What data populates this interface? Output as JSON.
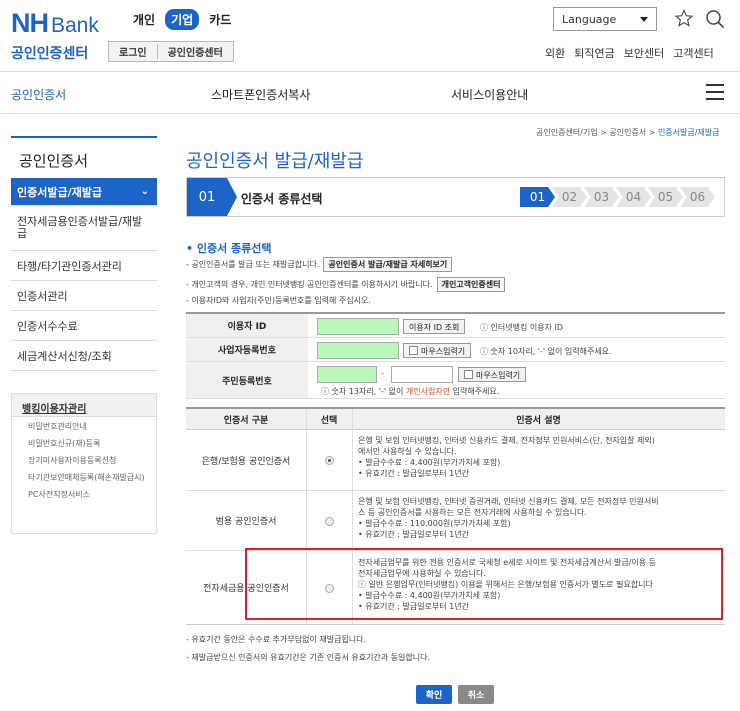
{
  "header": {
    "logo_nh": "NH",
    "logo_bank": "Bank",
    "biz_tabs": [
      "개인",
      "기업",
      "카드"
    ],
    "language_label": "Language",
    "site_title": "공인인증센터",
    "login_label": "로그인",
    "center_label": "공인인증센터",
    "util_links": [
      "외환",
      "퇴직연금",
      "보안센터",
      "고객센터"
    ]
  },
  "gnb": {
    "items": [
      "공인인증서",
      "스마트폰인증서복사",
      "서비스이용안내"
    ]
  },
  "sidebar": {
    "title": "공인인증서",
    "items": [
      {
        "label": "인증서발급/재발급",
        "chevron": "⌄"
      },
      {
        "label": "전자세금용인증서발급/재발급"
      },
      {
        "label": "타행/타기관인증서관리"
      },
      {
        "label": "인증서관리"
      },
      {
        "label": "인증서수수료"
      },
      {
        "label": "세금계산서신청/조회"
      }
    ],
    "banking": {
      "title": "뱅킹이용자관리",
      "items": [
        "비밀번호관리안내",
        "비밀번호신규(재)등록",
        "장기미사용자이용등록신청",
        "타기관보안매체등록(해손재발급시)",
        "PC사전지정서비스"
      ]
    }
  },
  "breadcrumb": {
    "path": "공인인증센터/기업 > 공인인증서 >",
    "current": "인증서발급/재발급"
  },
  "page_title": "공인인증서 발급/재발급",
  "step": {
    "number": "01",
    "label": "인증서 종류선택",
    "steps": [
      "01",
      "02",
      "03",
      "04",
      "05",
      "06"
    ]
  },
  "section_title": "• 인증서 종류선택",
  "notes": {
    "n1": "- 공인인증서를 발급 또는 재발급합니다.",
    "n1_btn": "공인인증서 발급/재발급 자세히보기",
    "n2": "- 개인고객의 경우, 개인 인터넷뱅킹 공인인증센터를 이용하시기 바랍니다.",
    "n2_btn": "개인고객인증센터",
    "n3": "- 이용자ID와 사업자(주민)등록번호를 입력해 주십시오."
  },
  "form": {
    "user_id_label": "이용자 ID",
    "user_id_btn": "이용자 ID 조회",
    "user_id_help": "ⓘ 인터넷뱅킹 이용자 ID",
    "biz_no_label": "사업자등록번호",
    "keyboard_label": "마우스입력기",
    "biz_no_help": "ⓘ 숫자 10자리, '-' 없이 입력해주세요.",
    "rrn_label": "주민등록번호",
    "dash": "-",
    "rrn_help_pre": "ⓘ 숫자 13자리, '-' 없이",
    "rrn_help_red": "개인사업자만",
    "rrn_help_post": "입력해주세요."
  },
  "cert_table": {
    "headers": [
      "인증서 구분",
      "선택",
      "인증서 설명"
    ],
    "rows": [
      {
        "name": "은행/보험용 공인인증서",
        "selected": true,
        "desc": [
          "은행 및 보험 인터넷뱅킹, 인터넷 신용카드 결제, 전자정부 민원서비스(단, 전자입찰 제외)",
          "에서만 사용하실 수 있습니다.",
          "• 발급수수료 : 4,400원(부가가치세 포함)",
          "• 유효기간 : 발급일로부터 1년간"
        ]
      },
      {
        "name": "범용 공인인증서",
        "selected": false,
        "desc": [
          "은행 및 보험 인터넷뱅킹, 인터넷 증권거래, 인터넷 신용카드 결제, 모든 전자정부 민원서비",
          "스 등 공인인증서를 사용하는 모든 전자거래에 사용하실 수 있습니다.",
          "• 발급수수료 : 110,000원(부가가치세 포함)",
          "• 유효기간 : 발급일로부터 1년간"
        ]
      },
      {
        "name": "전자세금용 공인인증서",
        "selected": false,
        "desc": [
          "전자세금업무를 위한 전용 인증서로 국세청 e세로 사이트 및 전자세금계산서 발급/이용 등",
          "전자세금업무에 사용하실 수 있습니다.",
          "ⓘ 일반 은행업무(인터넷뱅킹) 이용을 위해서는 은행/보험용 인증서가 별도로 필요합니다",
          "• 발급수수료 : 4,400원(부가가치세 포함)",
          "• 유효기간 : 발급일로부터 1년간"
        ]
      }
    ]
  },
  "footnotes": [
    "- 유효기간 동안은 수수료 추가부담없이 재발급됩니다.",
    "- 재발급받으신 인증서의 유효기간은 기존 인증서 유효기간과 동일합니다."
  ],
  "buttons": {
    "ok": "확인",
    "cancel": "취소"
  },
  "colors": {
    "accent": "#1c64c8",
    "input_highlight": "#b8f7b8",
    "alert_red": "#e02020"
  }
}
